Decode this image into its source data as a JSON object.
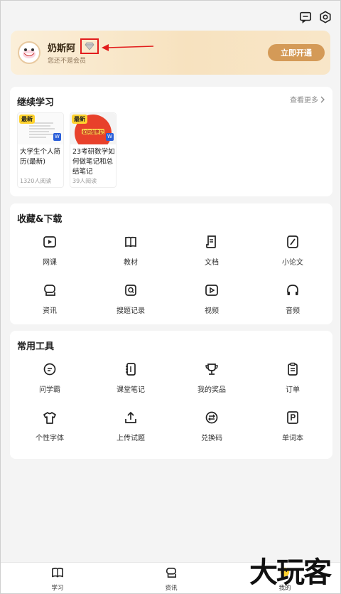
{
  "top": {
    "message_icon": "message-icon",
    "settings_icon": "settings-icon"
  },
  "member": {
    "username": "奶斯阿",
    "status": "您还不是会员",
    "open_button": "立即开通",
    "gem_icon": "diamond-icon"
  },
  "continue": {
    "title": "继续学习",
    "see_more": "查看更多",
    "books": [
      {
        "tag": "最新",
        "title": "大学生个人简历(最新)",
        "reads": "1320人阅读",
        "cover_text": ""
      },
      {
        "tag": "最新",
        "title": "23考研数学如何做笔记和总结笔记",
        "reads": "39人阅读",
        "cover_text": "如何做笔记"
      }
    ]
  },
  "favorites": {
    "title": "收藏&下载",
    "items": [
      {
        "label": "网课",
        "icon": "play-icon"
      },
      {
        "label": "教材",
        "icon": "book-icon"
      },
      {
        "label": "文档",
        "icon": "document-icon"
      },
      {
        "label": "小论文",
        "icon": "pen-icon"
      },
      {
        "label": "资讯",
        "icon": "news-icon"
      },
      {
        "label": "搜题记录",
        "icon": "search-icon"
      },
      {
        "label": "视频",
        "icon": "video-icon"
      },
      {
        "label": "音频",
        "icon": "headphones-icon"
      }
    ]
  },
  "tools": {
    "title": "常用工具",
    "items": [
      {
        "label": "问学霸",
        "icon": "chat-icon"
      },
      {
        "label": "课堂笔记",
        "icon": "notebook-icon"
      },
      {
        "label": "我的奖品",
        "icon": "trophy-icon"
      },
      {
        "label": "订单",
        "icon": "clipboard-icon"
      },
      {
        "label": "个性字体",
        "icon": "tshirt-icon"
      },
      {
        "label": "上传试题",
        "icon": "upload-icon"
      },
      {
        "label": "兑换码",
        "icon": "exchange-icon"
      },
      {
        "label": "单词本",
        "icon": "vocab-icon"
      }
    ]
  },
  "tabbar": [
    {
      "label": "学习",
      "icon": "study-icon"
    },
    {
      "label": "资讯",
      "icon": "news-tab-icon"
    },
    {
      "label": "我的",
      "icon": "profile-icon"
    }
  ],
  "watermark": "大玩客",
  "colors": {
    "accent": "#d49a57",
    "highlight": "#e21c1c",
    "tag": "#ffd22e"
  }
}
